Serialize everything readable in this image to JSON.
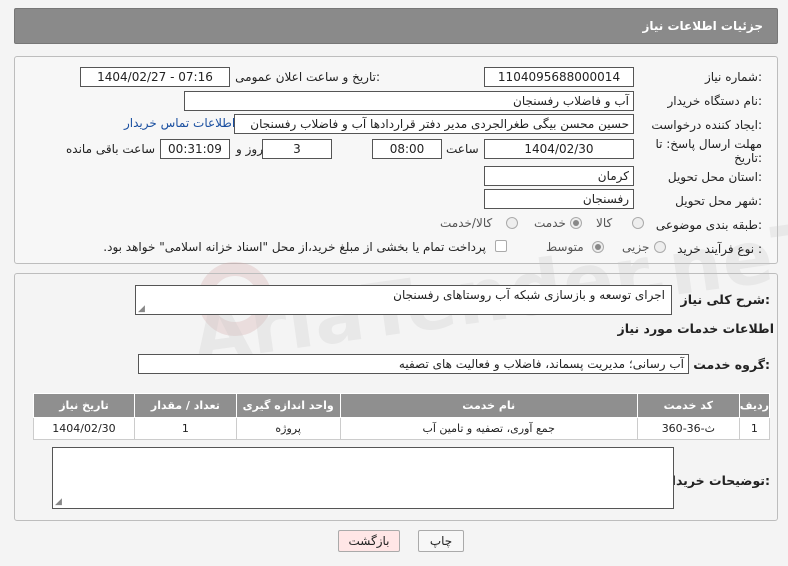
{
  "header": {
    "title": "جزئیات اطلاعات نیاز"
  },
  "form": {
    "need_number_label": "شماره نیاز:",
    "need_number": "1104095688000014",
    "announce_label": "تاریخ و ساعت اعلان عمومی:",
    "announce_value": "1404/02/27 - 07:16",
    "buyer_org_label": "نام دستگاه خریدار:",
    "buyer_org": "آب و فاضلاب رفسنجان",
    "requester_label": "ایجاد کننده درخواست:",
    "requester": "حسین محسن بیگی طغرالجردی مدیر دفتر قراردادها آب و فاضلاب رفسنجان",
    "contact_link": "اطلاعات تماس خریدار",
    "deadline_label_1": "مهلت ارسال پاسخ: تا",
    "deadline_label_2": "تاریخ:",
    "deadline_date": "1404/02/30",
    "time_label": "ساعت",
    "deadline_time": "08:00",
    "days_value": "3",
    "days_label": "روز و",
    "remaining_time": "00:31:09",
    "remaining_label": "ساعت باقی مانده",
    "province_label": "استان محل تحویل:",
    "province": "کرمان",
    "city_label": "شهر محل تحویل:",
    "city": "رفسنجان",
    "category_label": "طبقه بندی موضوعی:",
    "category_options": [
      "کالا",
      "خدمت",
      "کالا/خدمت"
    ],
    "category_selected": "خدمت",
    "process_label": "نوع فرآیند خرید :",
    "process_options": [
      "جزیی",
      "متوسط"
    ],
    "process_selected": "متوسط",
    "payment_note": "پرداخت تمام یا بخشی از مبلغ خرید،از محل \"اسناد خزانه اسلامی\" خواهد بود."
  },
  "summary": {
    "description_label": "شرح کلی نیاز:",
    "description": "اجرای توسعه و بازسازی شبکه آب روستاهای رفسنجان",
    "services_title": "اطلاعات خدمات مورد نیاز",
    "group_label": "گروه خدمت:",
    "group_value": "آب رسانی؛ مدیریت پسماند، فاضلاب و فعالیت های تصفیه"
  },
  "table": {
    "headers": [
      "ردیف",
      "کد خدمت",
      "نام خدمت",
      "واحد اندازه گیری",
      "تعداد / مقدار",
      "تاریخ نیاز"
    ],
    "rows": [
      [
        "1",
        "ث-36-360",
        "جمع آوری، تصفیه و تامین آب",
        "پروژه",
        "1",
        "1404/02/30"
      ]
    ]
  },
  "buyer_notes_label": "توضیحات خریدار:",
  "buttons": {
    "print": "چاپ",
    "back": "بازگشت"
  },
  "watermark": "AriaTender.neT"
}
